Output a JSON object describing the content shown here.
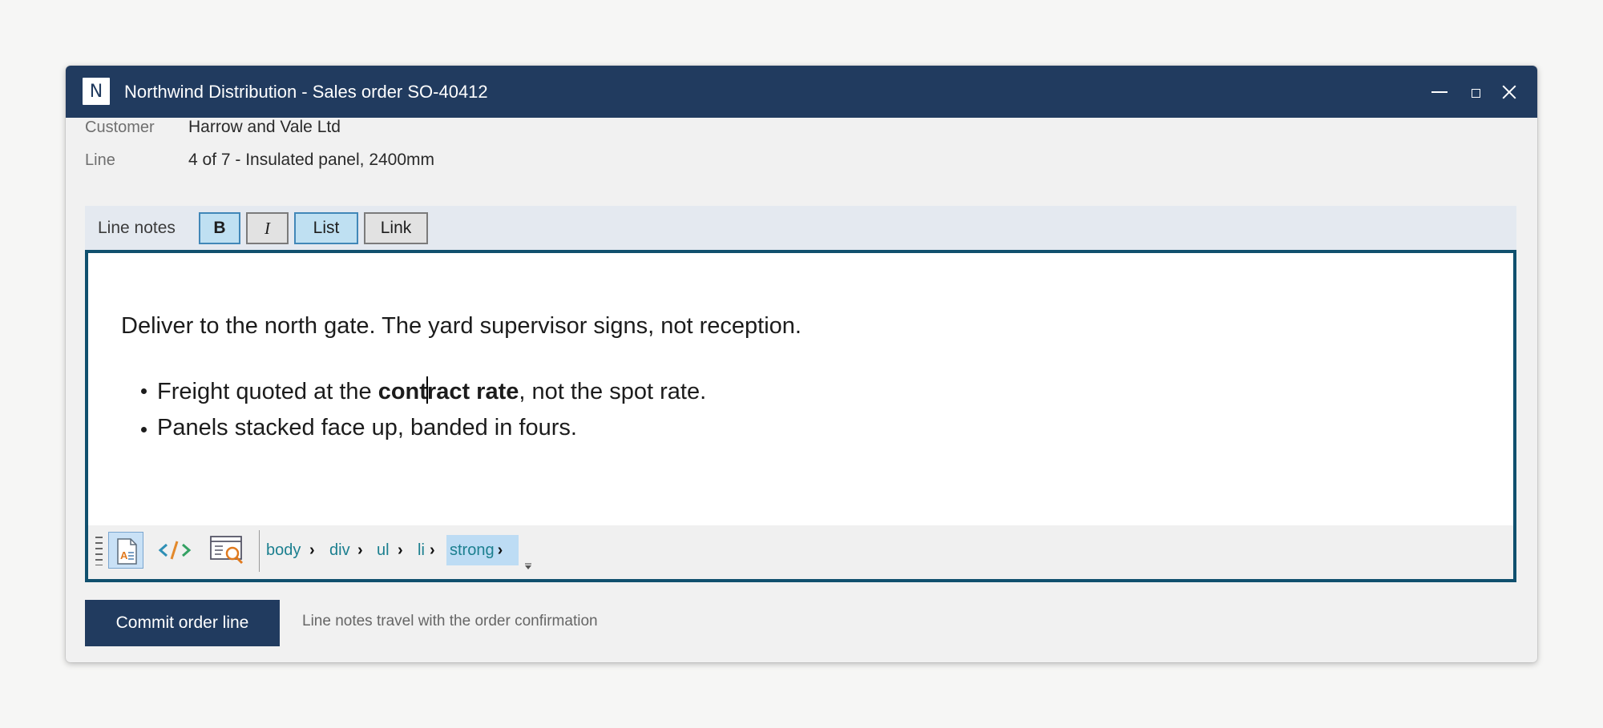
{
  "window": {
    "app_icon_letter": "N",
    "title": "Northwind Distribution - Sales order SO-40412"
  },
  "fields": {
    "customer_label": "Customer",
    "customer_value": "Harrow and Vale Ltd",
    "line_label": "Line",
    "line_value": "4 of 7 - Insulated panel, 2400mm"
  },
  "notes": {
    "label": "Line notes",
    "toolbar": [
      {
        "label": "B",
        "active": true
      },
      {
        "label": "I",
        "active": false
      },
      {
        "label": "List",
        "active": true
      },
      {
        "label": "Link",
        "active": false
      }
    ],
    "paragraph": "Deliver to the north gate. The yard supervisor signs, not reception.",
    "bullets": [
      {
        "before": "Freight quoted at the ",
        "bold_part1": "cont",
        "bold_part2": "ract rate",
        "after": ", not the spot rate."
      },
      {
        "text": "Panels stacked face up, banded in fours."
      }
    ]
  },
  "statusbar": {
    "view_modes": [
      "design-view-icon",
      "html-source-icon",
      "preview-icon"
    ],
    "breadcrumb": [
      "body",
      "div",
      "ul",
      "li",
      "strong"
    ],
    "active_crumb": "strong"
  },
  "footer": {
    "primary_button": "Commit order line",
    "hint": "Line notes travel with the order confirmation"
  },
  "colors": {
    "titlebar": "#213b5f",
    "editor_border": "#10506e",
    "active_toggle": "#bfe0f2",
    "crumb_text": "#1b7f8f"
  }
}
